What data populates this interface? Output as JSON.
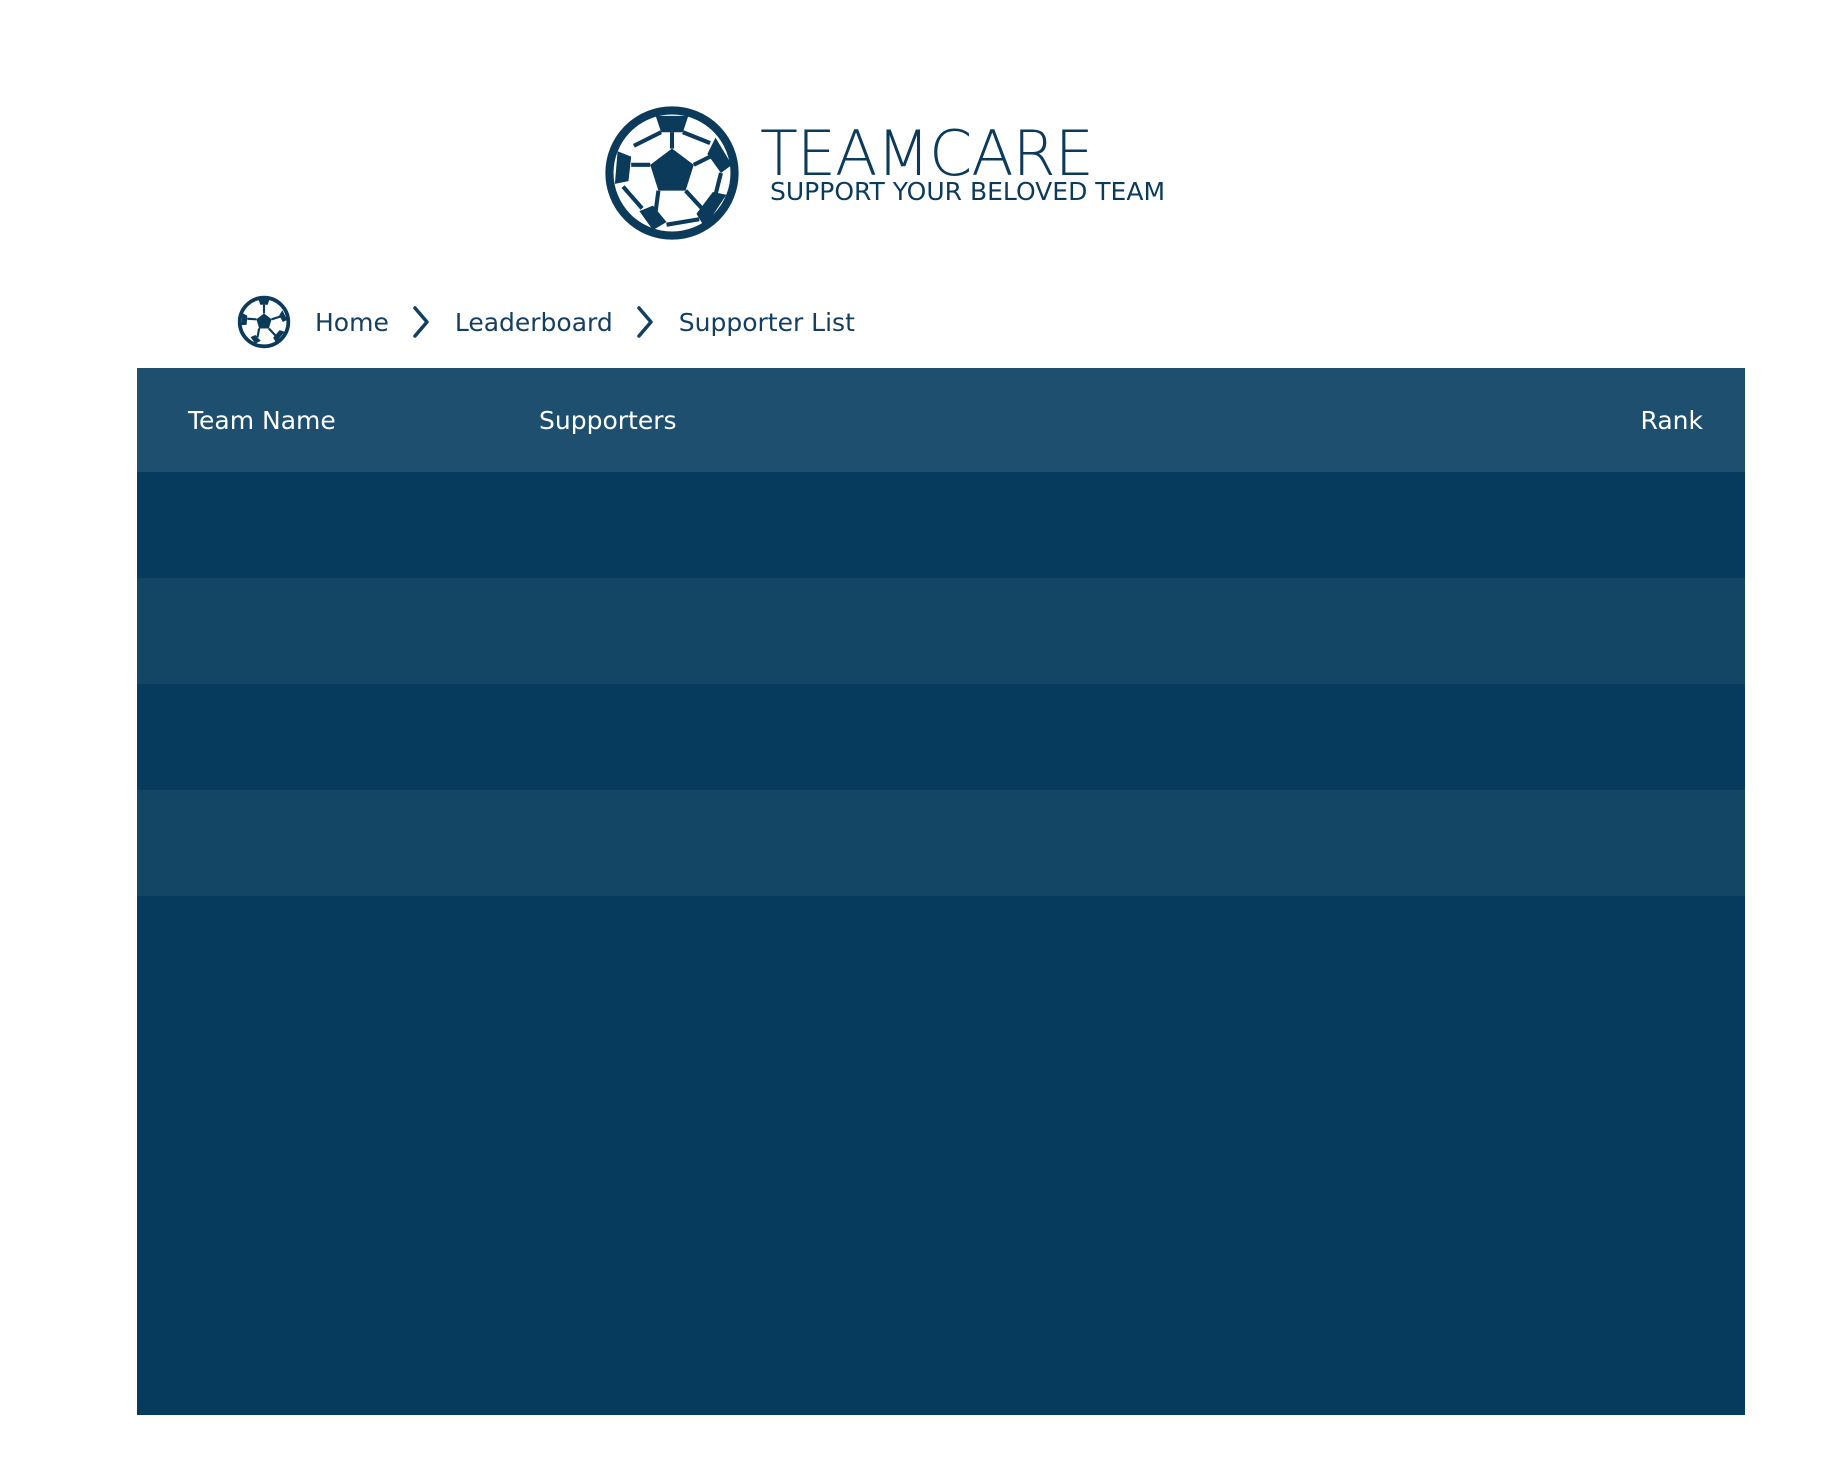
{
  "logo": {
    "title": "TEAMCARE",
    "subtitle": "SUPPORT YOUR BELOVED TEAM",
    "icon": "soccer-ball-icon"
  },
  "breadcrumb": {
    "home_icon": "soccer-ball-icon",
    "items": [
      {
        "label": "Home"
      },
      {
        "label": "Leaderboard"
      },
      {
        "label": "Supporter List"
      }
    ],
    "separator_icon": "chevron-right-icon"
  },
  "table": {
    "columns": {
      "team_name": "Team Name",
      "supporters": "Supporters",
      "rank": "Rank"
    },
    "rows": [
      {
        "team_name": "",
        "supporters": "",
        "rank": ""
      },
      {
        "team_name": "",
        "supporters": "",
        "rank": ""
      },
      {
        "team_name": "",
        "supporters": "",
        "rank": ""
      },
      {
        "team_name": "",
        "supporters": "",
        "rank": ""
      }
    ]
  },
  "colors": {
    "brand_navy": "#0b3a5b",
    "table_body": "#063b5e",
    "table_header": "#1e4f6f",
    "row_alt": "#134565",
    "header_text": "#ffffff"
  }
}
